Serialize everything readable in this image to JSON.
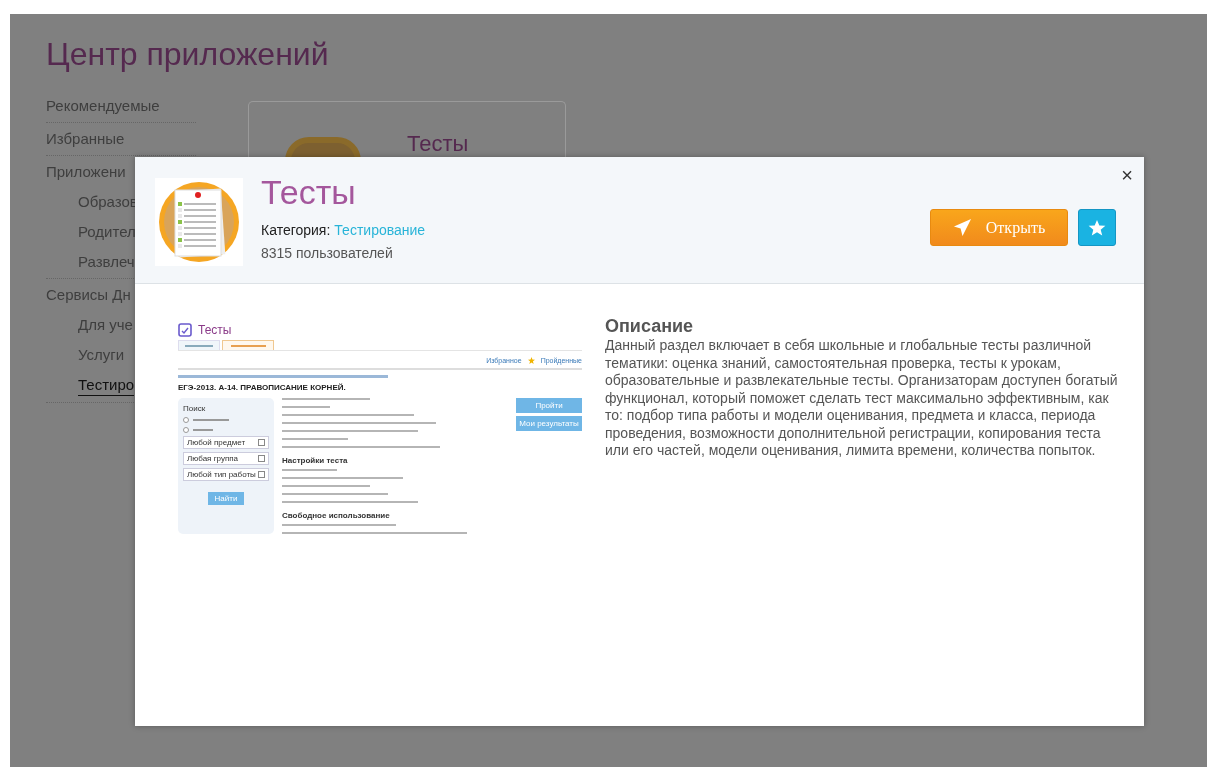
{
  "page": {
    "title": "Центр приложений",
    "sidebar": [
      {
        "label": "Рекомендуемые",
        "selected": false
      },
      {
        "label": "Избранные",
        "selected": false
      },
      {
        "label": "Приложени",
        "selected": false,
        "children": [
          {
            "label": "Образов",
            "selected": false
          },
          {
            "label": "Родител",
            "selected": false
          },
          {
            "label": "Развлеч",
            "selected": false
          }
        ]
      },
      {
        "label": "Сервисы Дн",
        "selected": false,
        "children": [
          {
            "label": "Для уче",
            "selected": false
          },
          {
            "label": "Услуги",
            "selected": false
          },
          {
            "label": "Тестиро",
            "selected": true
          }
        ]
      }
    ],
    "card": {
      "title": "Тесты"
    }
  },
  "modal": {
    "close": "×",
    "app": {
      "title": "Тесты",
      "category_label": "Категория:",
      "category": "Тестирование",
      "users": "8315 пользователей"
    },
    "open_button": "Открыть",
    "preview": {
      "title": "Тесты",
      "links": [
        "Избранное",
        "Пройденные"
      ],
      "heading": "ЕГЭ-2013. А-14. ПРАВОПИСАНИЕ КОРНЕЙ.",
      "search": {
        "title": "Поиск",
        "selects": [
          "Любой предмет",
          "Любая группа",
          "Любой тип работы"
        ],
        "button": "Найти"
      },
      "buttons": [
        "Пройти",
        "Мои результаты"
      ],
      "sections": [
        "Настройки теста",
        "Свободное использование"
      ]
    },
    "description": {
      "title": "Описание",
      "text": "Данный раздел включает в себя школьные и глобальные тесты различной тематики: оценка знаний, самостоятельная проверка, тесты к урокам, образовательные и развлекательные тесты. Организаторам доступен богатый функционал, который поможет сделать тест максимально эффективным, как то: подбор типа работы и модели оценивания, предмета и класса, периода проведения, возможности дополнительной регистрации, копирования теста или его частей, модели оценивания, лимита времени, количества попыток."
    }
  }
}
